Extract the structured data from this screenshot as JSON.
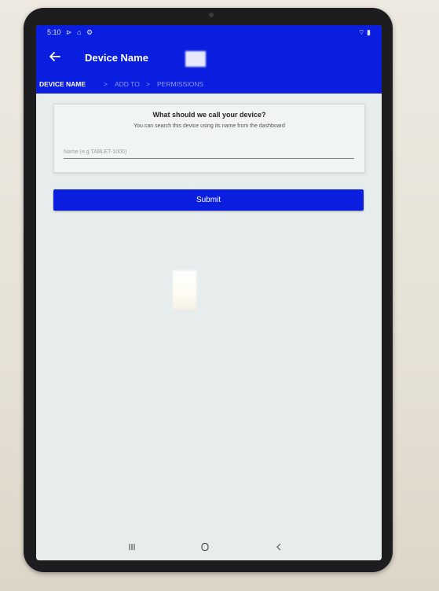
{
  "status_bar": {
    "time": "5:10",
    "icons": "⊳ ⌂ ⚙",
    "right": "⌔ ▮"
  },
  "app_bar": {
    "title": "Device Name",
    "back_icon": "arrow-left-icon"
  },
  "steps": [
    {
      "label": "DEVICE NAME",
      "active": true
    },
    {
      "label": "ADD TO",
      "active": false
    },
    {
      "label": "PERMISSIONS",
      "active": false
    }
  ],
  "step_separator": ">",
  "card": {
    "title": "What should we call your device?",
    "subtitle": "You can search this device using its name from the dashboard",
    "input_placeholder": "Name (e.g TABLET-1000)",
    "input_value": ""
  },
  "submit_label": "Submit",
  "nav_bar": {
    "recents_icon": "recents-icon",
    "home_icon": "home-icon",
    "back_icon": "back-chevron-icon"
  },
  "colors": {
    "primary": "#0a1ee0",
    "screen_bg": "#e7ecec",
    "inactive_step": "#8f99f5"
  }
}
